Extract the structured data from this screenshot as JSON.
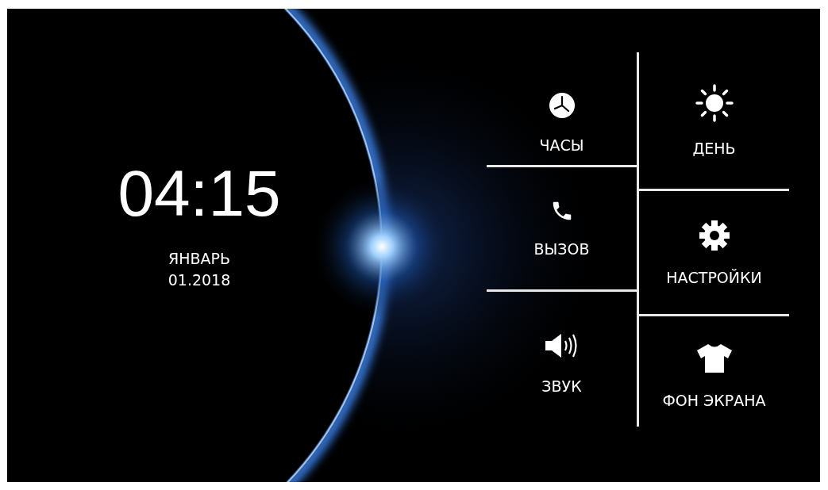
{
  "clock": {
    "time": "04:15",
    "month": "ЯНВАРЬ",
    "date": "01.2018"
  },
  "menu": {
    "columns": [
      {
        "items": [
          {
            "label": "ЧАСЫ",
            "kind": "clock"
          },
          {
            "label": "ВЫЗОВ",
            "kind": "phone"
          },
          {
            "label": "ЗВУК",
            "kind": "speaker"
          }
        ]
      },
      {
        "items": [
          {
            "label": "ДЕНЬ",
            "kind": "sun"
          },
          {
            "label": "НАСТРОЙКИ",
            "kind": "gear"
          },
          {
            "label": "ФОН ЭКРАНА",
            "kind": "shirt"
          }
        ]
      }
    ]
  }
}
